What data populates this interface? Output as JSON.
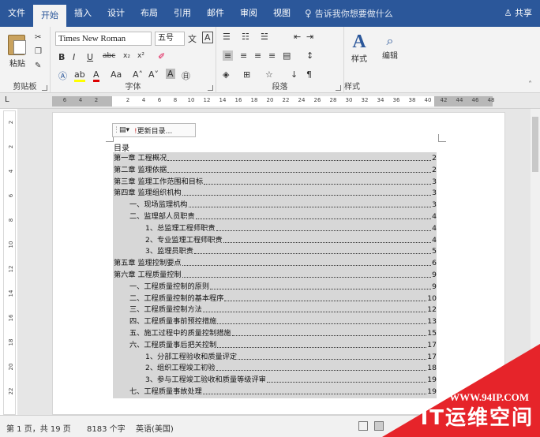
{
  "tabs": [
    "文件",
    "开始",
    "插入",
    "设计",
    "布局",
    "引用",
    "邮件",
    "审阅",
    "视图"
  ],
  "tell_me": "告诉我你想要做什么",
  "share": "共享",
  "ribbon": {
    "clipboard_label": "剪贴板",
    "paste": "粘贴",
    "font_label": "字体",
    "font_name": "Times New Roman",
    "font_size": "五号",
    "paragraph_label": "段落",
    "styles_label": "样式",
    "styles_btn": "样式",
    "edit_btn": "编辑"
  },
  "toc_bar": {
    "update": "更新目录..."
  },
  "toc_title": "目录",
  "toc": [
    {
      "text": "第一章   工程概况",
      "page": "2",
      "level": 0
    },
    {
      "text": "第二章   监理依据",
      "page": "2",
      "level": 0
    },
    {
      "text": "第三章   监理工作范围和目标",
      "page": "3",
      "level": 0
    },
    {
      "text": "第四章     监理组织机构",
      "page": "3",
      "level": 0
    },
    {
      "text": "一、现场监理机构",
      "page": "3",
      "level": 1
    },
    {
      "text": "二、监理部人员职责",
      "page": "4",
      "level": 1
    },
    {
      "text": "1、总监理工程师职责",
      "page": "4",
      "level": 2
    },
    {
      "text": "2、专业监理工程师职责",
      "page": "4",
      "level": 2
    },
    {
      "text": "3、监理员职责",
      "page": "5",
      "level": 2
    },
    {
      "text": "第五章   监理控制要点",
      "page": "6",
      "level": 0
    },
    {
      "text": "第六章   工程质量控制",
      "page": "9",
      "level": 0
    },
    {
      "text": "一、工程质量控制的原则",
      "page": "9",
      "level": 1
    },
    {
      "text": "二、工程质量控制的基本程序",
      "page": "10",
      "level": 1
    },
    {
      "text": "三、工程质量控制方法",
      "page": "12",
      "level": 1
    },
    {
      "text": "四、工程质量事前预控措施",
      "page": "13",
      "level": 1
    },
    {
      "text": "五、施工过程中的质量控制措施",
      "page": "15",
      "level": 1
    },
    {
      "text": "六、工程质量事后把关控制",
      "page": "17",
      "level": 1
    },
    {
      "text": "1、分部工程验收和质量评定",
      "page": "17",
      "level": 2
    },
    {
      "text": "2、组织工程竣工初验",
      "page": "18",
      "level": 2
    },
    {
      "text": "3、参与工程竣工验收和质量等级评审",
      "page": "19",
      "level": 2
    },
    {
      "text": "七、工程质量事故处理",
      "page": "19",
      "level": 1
    }
  ],
  "ruler_ticks": [
    "6",
    "4",
    "2",
    "2",
    "4",
    "6",
    "8",
    "10",
    "12",
    "14",
    "16",
    "18",
    "20",
    "22",
    "24",
    "26",
    "28",
    "30",
    "32",
    "34",
    "36",
    "38",
    "40",
    "42",
    "44",
    "46",
    "48"
  ],
  "vruler_ticks": [
    "2",
    "2",
    "4",
    "6",
    "8",
    "10",
    "12",
    "14",
    "16",
    "18",
    "20",
    "22"
  ],
  "status": {
    "page": "第 1 页，共 19 页",
    "words": "8183 个字",
    "lang": "英语(美国)"
  },
  "watermark": {
    "url": "WWW.94IP.COM",
    "brand": "IT运维空间"
  },
  "colors": {
    "ribbon_blue": "#2b579a",
    "toc_shading": "#d7d7d7",
    "watermark_red": "#e6242a"
  }
}
